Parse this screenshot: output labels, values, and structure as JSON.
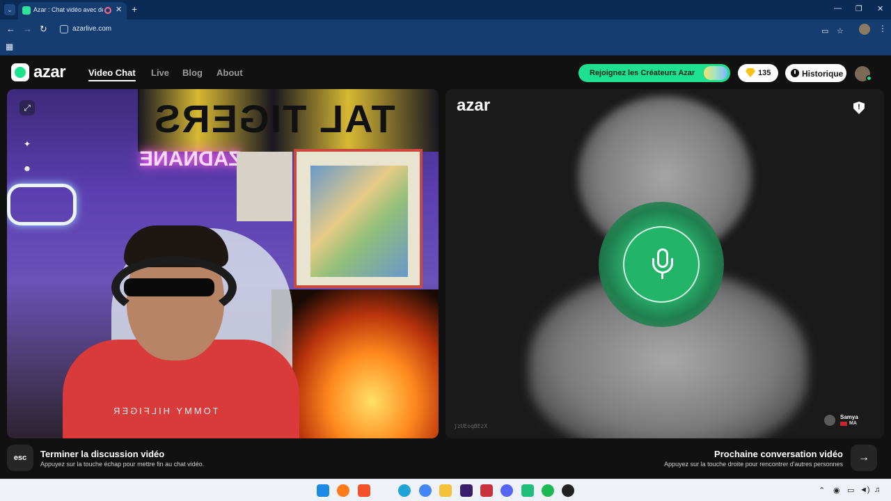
{
  "browser": {
    "tab_title": "Azar : Chat vidéo avec de n",
    "tab_close": "✕",
    "new_tab": "+",
    "url": "azarlive.com",
    "window_controls": [
      "—",
      "❐",
      "✕"
    ]
  },
  "site": {
    "logo": "azar",
    "nav": [
      "Video Chat",
      "Live",
      "Blog",
      "About"
    ],
    "cta_label": "Rejoignez les Créateurs Azar",
    "gems_count": "135",
    "history_label": "Historique"
  },
  "left_video": {
    "flag_text": "TAL TIGERS",
    "neon_text": "ZADNANE",
    "shirt_text": "TOMMY HILFIGER"
  },
  "right_video": {
    "logo": "azar",
    "report_symbol": "!",
    "room_id": "jzUEoqBEzX",
    "peer_name": "Samya",
    "peer_country": "MA"
  },
  "shortcuts": {
    "esc_key": "esc",
    "end_title": "Terminer la discussion vidéo",
    "end_hint": "Appuyez sur la touche échap pour mettre fin au chat vidéo.",
    "next_title": "Prochaine conversation vidéo",
    "next_hint": "Appuyez sur la touche droite pour rencontrer d'autres personnes",
    "next_key": "→"
  },
  "colors": {
    "accent_green": "#1ee08e",
    "mic_green": "#22b468",
    "chrome_blue": "#163d70"
  }
}
